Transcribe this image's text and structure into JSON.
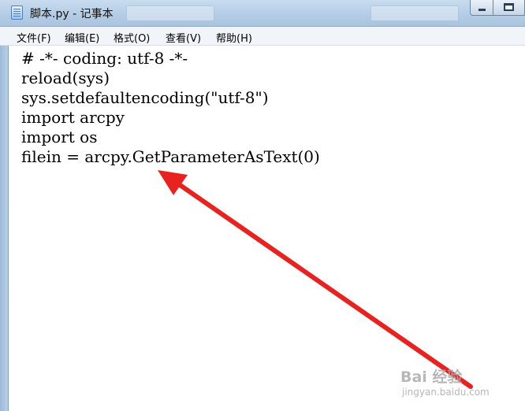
{
  "window": {
    "title": "脚本.py - 记事本"
  },
  "menu": {
    "items": [
      "文件(F)",
      "编辑(E)",
      "格式(O)",
      "查看(V)",
      "帮助(H)"
    ]
  },
  "editor": {
    "lines": [
      "# -*- coding: utf-8 -*-",
      "reload(sys)",
      "sys.setdefaultencoding(\"utf-8\")",
      "import arcpy",
      "import os",
      "filein = arcpy.GetParameterAsText(0)"
    ]
  },
  "annotation": {
    "arrow_color": "#e8231f"
  },
  "watermark": {
    "main": "Bai 经验",
    "sub": "jingyan.baidu.com"
  },
  "icons": {
    "app": "notepad-icon",
    "minimize": "minimize-icon",
    "maximize": "maximize-icon"
  }
}
